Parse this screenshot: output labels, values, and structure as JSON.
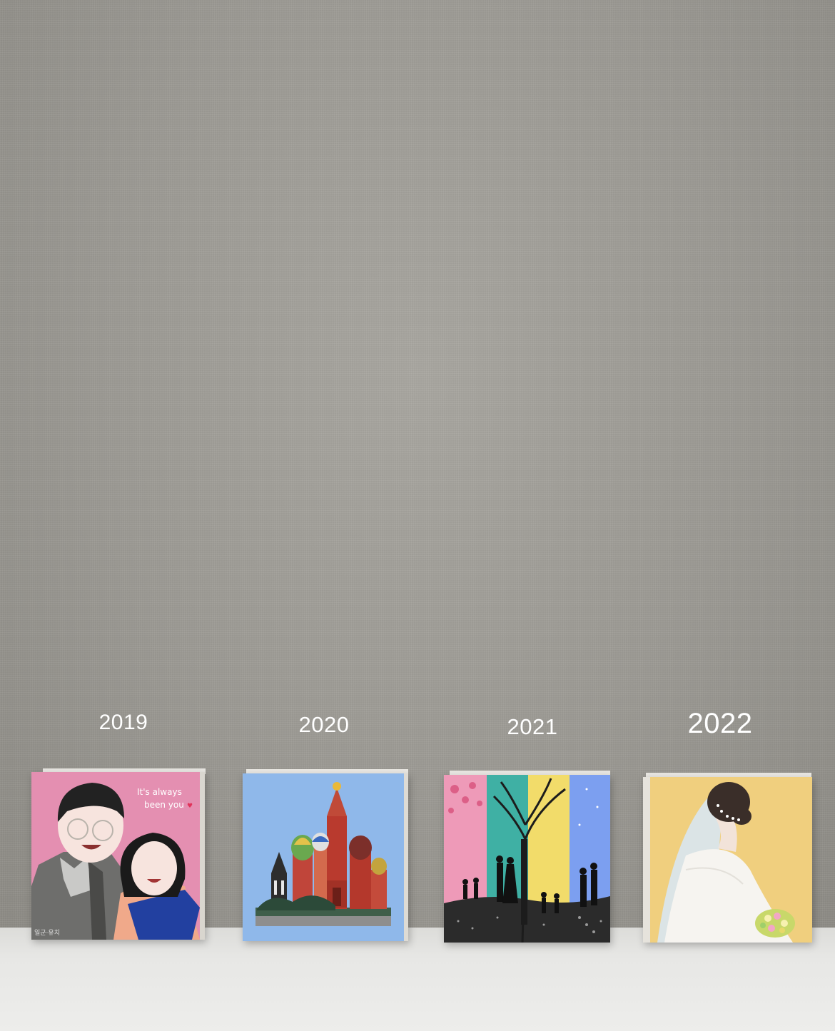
{
  "years": [
    "2019",
    "2020",
    "2021",
    "2022"
  ],
  "paintings": [
    {
      "year": "2019",
      "text_line1": "It's always",
      "text_line2": "been you",
      "signature": "일군·유치",
      "heart": "♥",
      "bg": "#e48fb1"
    },
    {
      "year": "2020",
      "bg": "#8fb8ea"
    },
    {
      "year": "2021",
      "panels": [
        "#ee9ab8",
        "#3fb0a4",
        "#f2dc6a",
        "#7c9ff0"
      ]
    },
    {
      "year": "2022",
      "bg": "#f0cf7e"
    }
  ]
}
